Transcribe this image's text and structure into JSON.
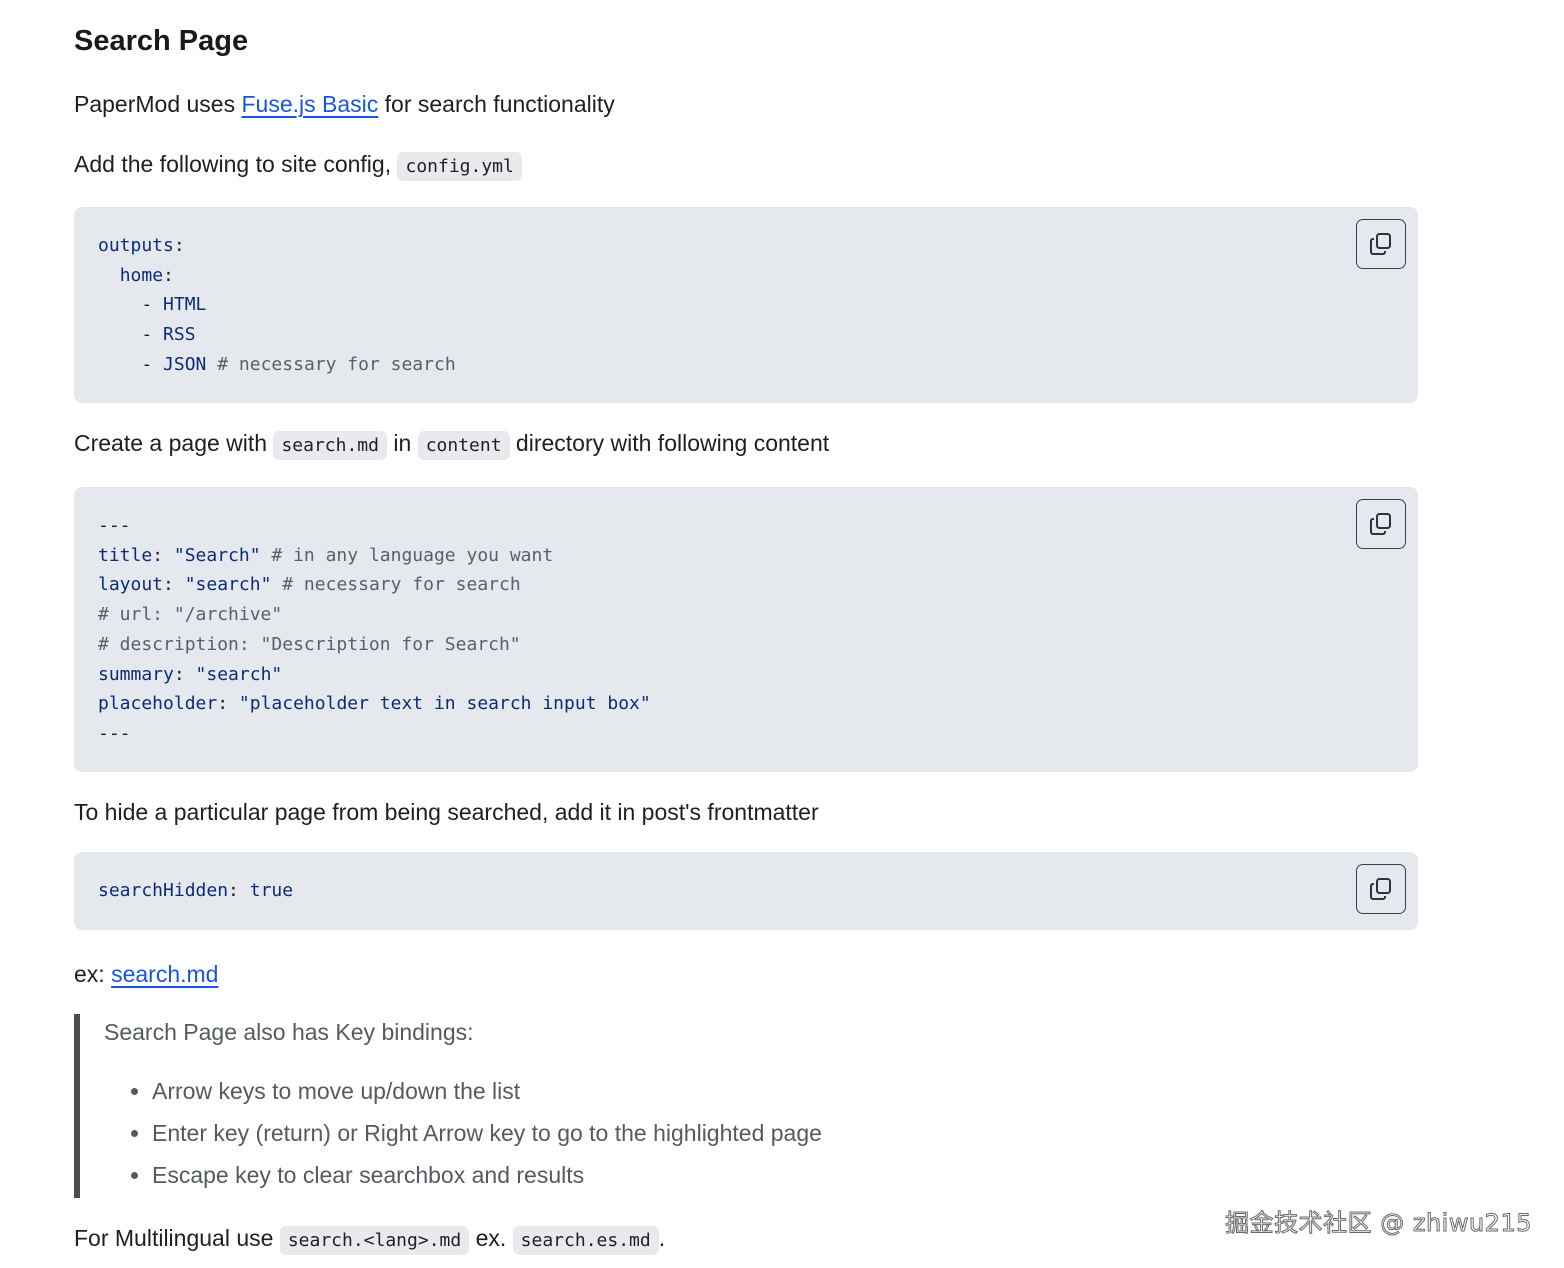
{
  "heading": "Search Page",
  "intro": {
    "prefix": "PaperMod uses ",
    "link": "Fuse.js Basic",
    "suffix": " for search functionality"
  },
  "config_line": {
    "text": "Add the following to site config, ",
    "code": "config.yml"
  },
  "code1": {
    "lines": [
      {
        "key": "outputs",
        "punct": ":"
      },
      {
        "indent": "  ",
        "key": "home",
        "punct": ":"
      },
      {
        "indent": "    ",
        "dash": "- ",
        "value": "HTML"
      },
      {
        "indent": "    ",
        "dash": "- ",
        "value": "RSS"
      },
      {
        "indent": "    ",
        "dash": "- ",
        "value": "JSON",
        "comment": " # necessary for search"
      }
    ]
  },
  "create_line": {
    "prefix": "Create a page with ",
    "code1": "search.md",
    "mid": " in ",
    "code2": "content",
    "suffix": " directory with following content"
  },
  "code2": {
    "dashes_top": "---",
    "title_key": "title",
    "title_val": "\"Search\"",
    "title_comment": " # in any language you want",
    "layout_key": "layout",
    "layout_val": "\"search\"",
    "layout_comment": " # necessary for search",
    "url_comment": "# url: \"/archive\"",
    "desc_comment": "# description: \"Description for Search\"",
    "summary_key": "summary",
    "summary_val": "\"search\"",
    "placeholder_key": "placeholder",
    "placeholder_val": "\"placeholder text in search input box\"",
    "dashes_bottom": "---"
  },
  "hide_line": "To hide a particular page from being searched, add it in post's frontmatter",
  "code3": {
    "key": "searchHidden",
    "value": "true"
  },
  "example": {
    "prefix": "ex: ",
    "link": "search.md"
  },
  "quote": {
    "intro": "Search Page also has Key bindings:",
    "items": [
      "Arrow keys to move up/down the list",
      "Enter key (return) or Right Arrow key to go to the highlighted page",
      "Escape key to clear searchbox and results"
    ]
  },
  "multilingual": {
    "prefix": "For Multilingual use ",
    "code1": "search.<lang>.md",
    "mid": " ex. ",
    "code2": "search.es.md",
    "suffix": "."
  },
  "watermark": "掘金技术社区 @ zhiwu215",
  "icons": {
    "copy": "copy-icon"
  }
}
